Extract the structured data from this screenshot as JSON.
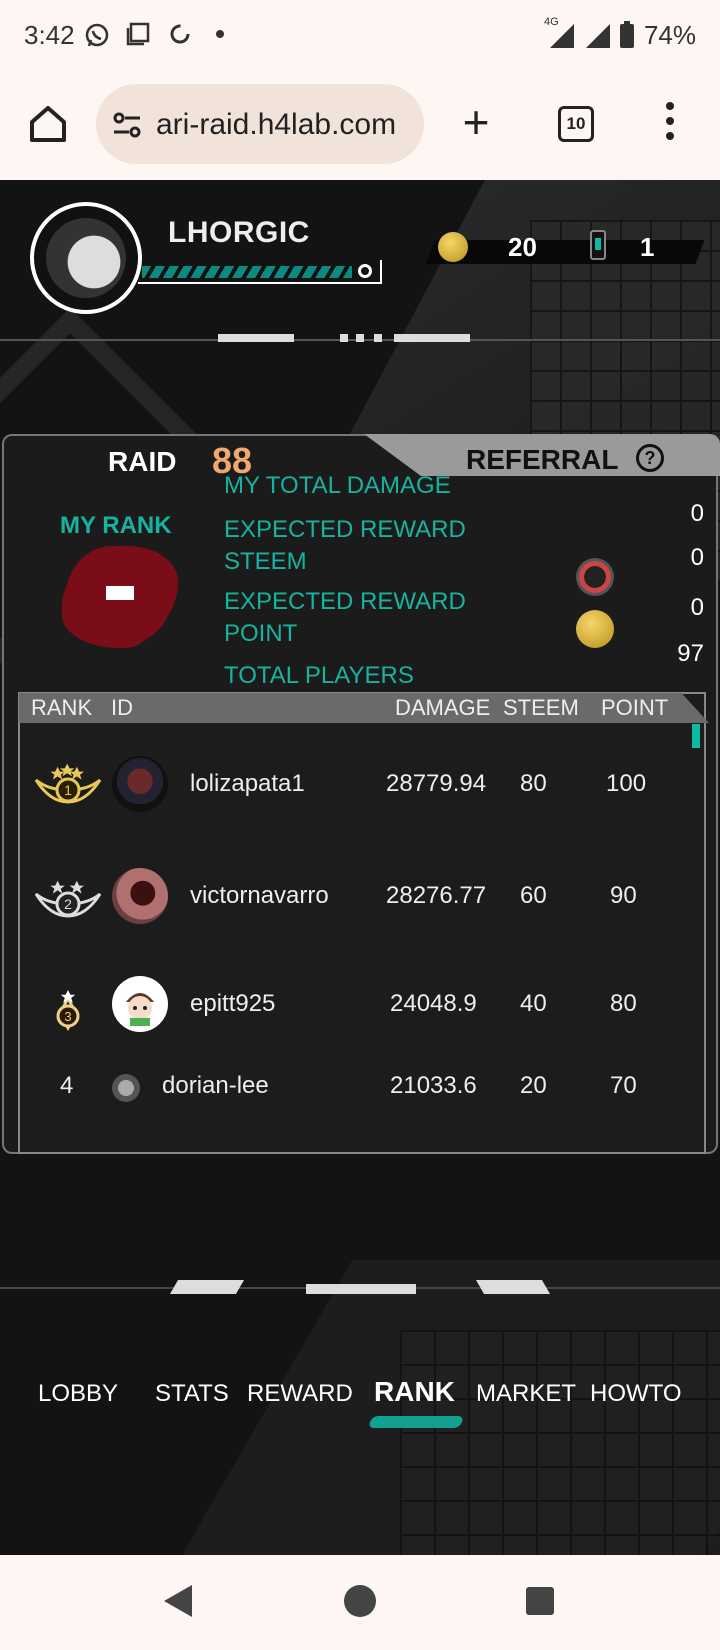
{
  "status_bar": {
    "time": "3:42",
    "network": "4G",
    "battery": "74%"
  },
  "browser": {
    "url": "ari-raid.h4lab.com",
    "tab_count": "10"
  },
  "header": {
    "player_name": "LHORGIC",
    "coins": "20",
    "tickets": "1",
    "xp_progress": 0.86
  },
  "panel": {
    "tab_raid": "RAID",
    "raid_number": "88",
    "tab_referral": "REFERRAL",
    "help_glyph": "?",
    "my_rank_label": "MY RANK",
    "stats": [
      {
        "label": "MY TOTAL DAMAGE",
        "value": "0"
      },
      {
        "label": "EXPECTED REWARD STEEM",
        "value": "0"
      },
      {
        "label": "EXPECTED REWARD POINT",
        "value": "0"
      },
      {
        "label": "TOTAL PLAYERS",
        "value": "97"
      }
    ]
  },
  "table": {
    "headers": {
      "rank": "RANK",
      "id": "ID",
      "damage": "DAMAGE",
      "steem": "STEEM",
      "point": "POINT"
    },
    "rows": [
      {
        "rank": "1",
        "id": "lolizapata1",
        "damage": "28779.94",
        "steem": "80",
        "point": "100"
      },
      {
        "rank": "2",
        "id": "victornavarro",
        "damage": "28276.77",
        "steem": "60",
        "point": "90"
      },
      {
        "rank": "3",
        "id": "epitt925",
        "damage": "24048.9",
        "steem": "40",
        "point": "80"
      },
      {
        "rank": "4",
        "id": "dorian-lee",
        "damage": "21033.6",
        "steem": "20",
        "point": "70"
      }
    ]
  },
  "nav": {
    "lobby": "LOBBY",
    "stats": "STATS",
    "reward": "REWARD",
    "rank": "RANK",
    "market": "MARKET",
    "howto": "HOWTO"
  },
  "colors": {
    "accent": "#10b8a6",
    "raid_number": "#f0a870",
    "rank_splat": "#7a0d18"
  }
}
